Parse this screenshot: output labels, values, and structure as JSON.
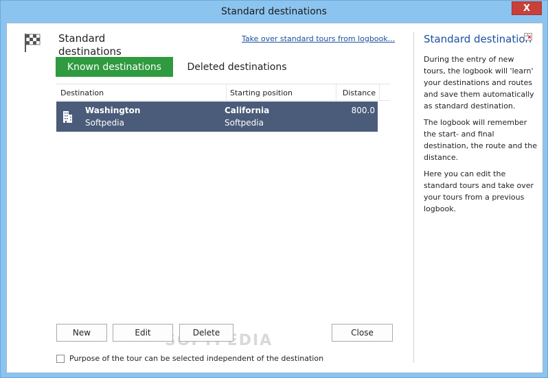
{
  "window": {
    "title": "Standard destinations",
    "close_glyph": "X"
  },
  "header": {
    "title": "Standard destinations",
    "takeover_link": "Take over standard tours from logbook..."
  },
  "tabs": [
    {
      "label": "Known destinations",
      "active": true
    },
    {
      "label": "Deleted destinations",
      "active": false
    }
  ],
  "table": {
    "columns": [
      "Destination",
      "Starting position",
      "Distance"
    ],
    "rows": [
      {
        "destination": "Washington",
        "destination_sub": "Softpedia",
        "start": "California",
        "start_sub": "Softpedia",
        "distance": "800.0",
        "selected": true
      }
    ]
  },
  "buttons": {
    "new": "New",
    "edit": "Edit",
    "delete": "Delete",
    "close": "Close"
  },
  "watermark": "SOFTPEDIA",
  "checkbox": {
    "label": "Purpose of the tour can be selected independent of the destination",
    "checked": false
  },
  "help": {
    "title": "Standard destination",
    "paragraphs": [
      "During the entry of new tours, the logbook will 'learn' your destinations and routes and save them automatically as standard destination.",
      "The logbook will remember the start- and final destination, the route and the distance.",
      "Here you can edit the standard tours and take over your tours from a previous logbook."
    ]
  },
  "colors": {
    "accent_tab": "#2f9a3f",
    "selected_row": "#4b5b7a",
    "link": "#1a4fa0",
    "title_bar": "#8cc4f0",
    "close_button": "#c7413a"
  },
  "icons": {
    "header": "checkered-flag-icon",
    "row": "building-icon",
    "help_close": "help-close-icon"
  }
}
